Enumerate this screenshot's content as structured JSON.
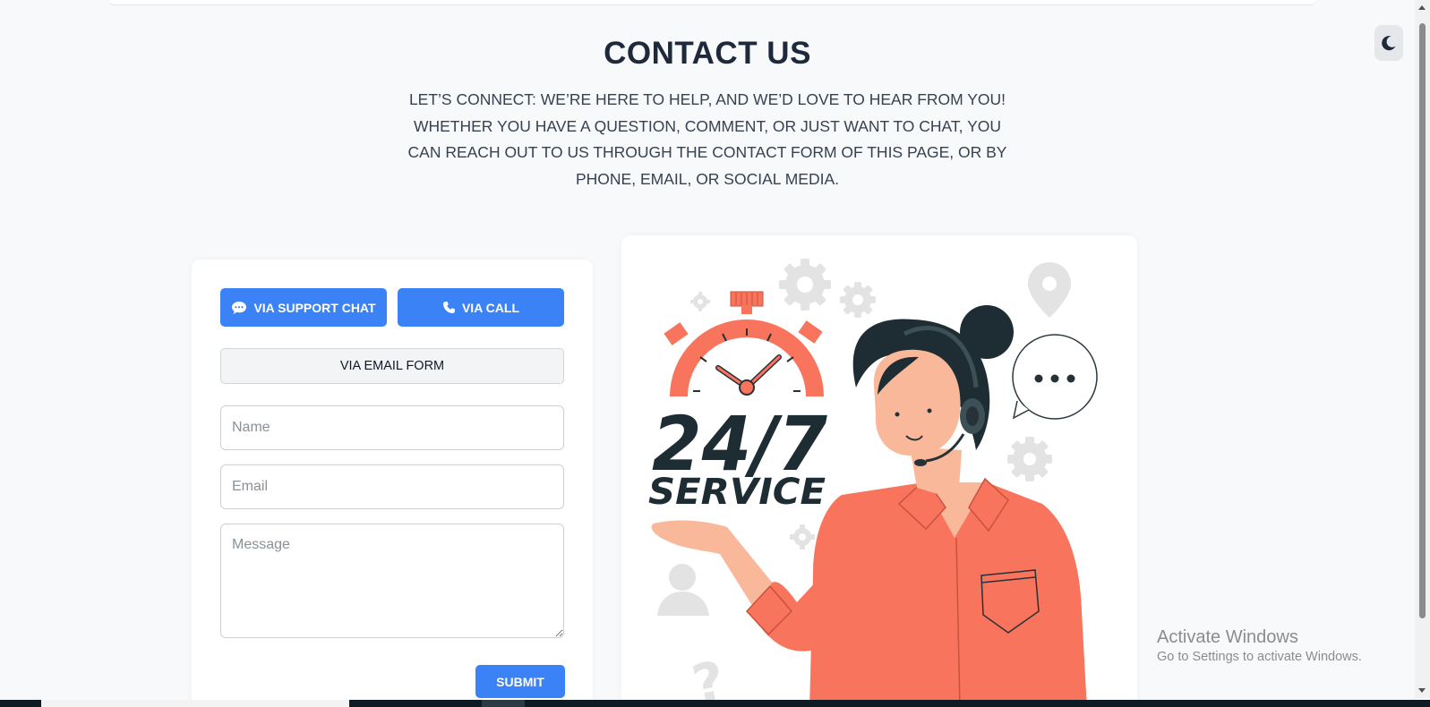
{
  "header": {
    "title": "CONTACT US",
    "intro": "LET’S CONNECT: WE’RE HERE TO HELP, AND WE’D LOVE TO HEAR FROM YOU! WHETHER YOU HAVE A QUESTION, COMMENT, OR JUST WANT TO CHAT, YOU CAN REACH OUT TO US THROUGH THE CONTACT FORM OF THIS PAGE, OR BY PHONE, EMAIL, OR SOCIAL MEDIA."
  },
  "theme_toggle": {
    "icon": "moon-icon"
  },
  "contact_options": {
    "chat_label": "VIA SUPPORT CHAT",
    "chat_icon": "chat-bubble-icon",
    "call_label": "VIA CALL",
    "call_icon": "phone-icon",
    "email_label": "VIA EMAIL FORM"
  },
  "form": {
    "name_placeholder": "Name",
    "email_placeholder": "Email",
    "message_placeholder": "Message",
    "submit_label": "SUBMIT"
  },
  "illustration": {
    "headline": "24/7",
    "subline": "SERVICE"
  },
  "watermark": {
    "title": "Activate Windows",
    "subtitle": "Go to Settings to activate Windows."
  },
  "colors": {
    "primary": "#3b82f6",
    "accent_coral": "#f8745c",
    "dark": "#1e2d33",
    "background": "#f8f9fa"
  }
}
